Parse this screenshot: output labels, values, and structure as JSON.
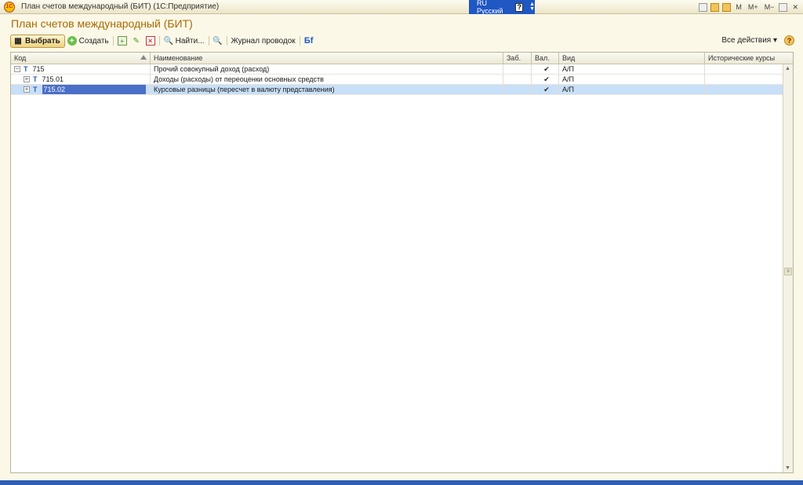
{
  "window": {
    "title": "План счетов международный (БИТ)  (1С:Предприятие)",
    "logo_text": "1С",
    "language": "RU Русский",
    "help_glyph": "?",
    "memory_buttons": [
      "M",
      "M+",
      "M−"
    ]
  },
  "form": {
    "title": "План счетов международный (БИТ)"
  },
  "toolbar": {
    "select_label": "Выбрать",
    "create_label": "Создать",
    "find_label": "Найти...",
    "journal_label": "Журнал проводок",
    "all_actions_label": "Все действия ▾",
    "help_label": "?"
  },
  "table": {
    "columns": [
      "Код",
      "Наименование",
      "Заб.",
      "Вал.",
      "Вид",
      "Исторические курсы"
    ],
    "rows": [
      {
        "code": "715",
        "name": "Прочий совокупный доход (расход)",
        "zab": "",
        "val": "✔",
        "vid": "А/П",
        "hist": "",
        "tree": "−",
        "level": 0
      },
      {
        "code": "715.01",
        "name": "Доходы (расходы) от переоценки основных средств",
        "zab": "",
        "val": "✔",
        "vid": "А/П",
        "hist": "",
        "tree": "+",
        "level": 1
      },
      {
        "code": "715.02",
        "name": "Курсовые разницы (пересчет в валюту представления)",
        "zab": "",
        "val": "✔",
        "vid": "А/П",
        "hist": "",
        "tree": "+",
        "level": 1
      }
    ]
  },
  "colors": {
    "accent_title": "#a86a00",
    "selection_row": "#c8dff8",
    "selection_cell": "#4a6fc8",
    "language_box": "#1f57c3"
  }
}
